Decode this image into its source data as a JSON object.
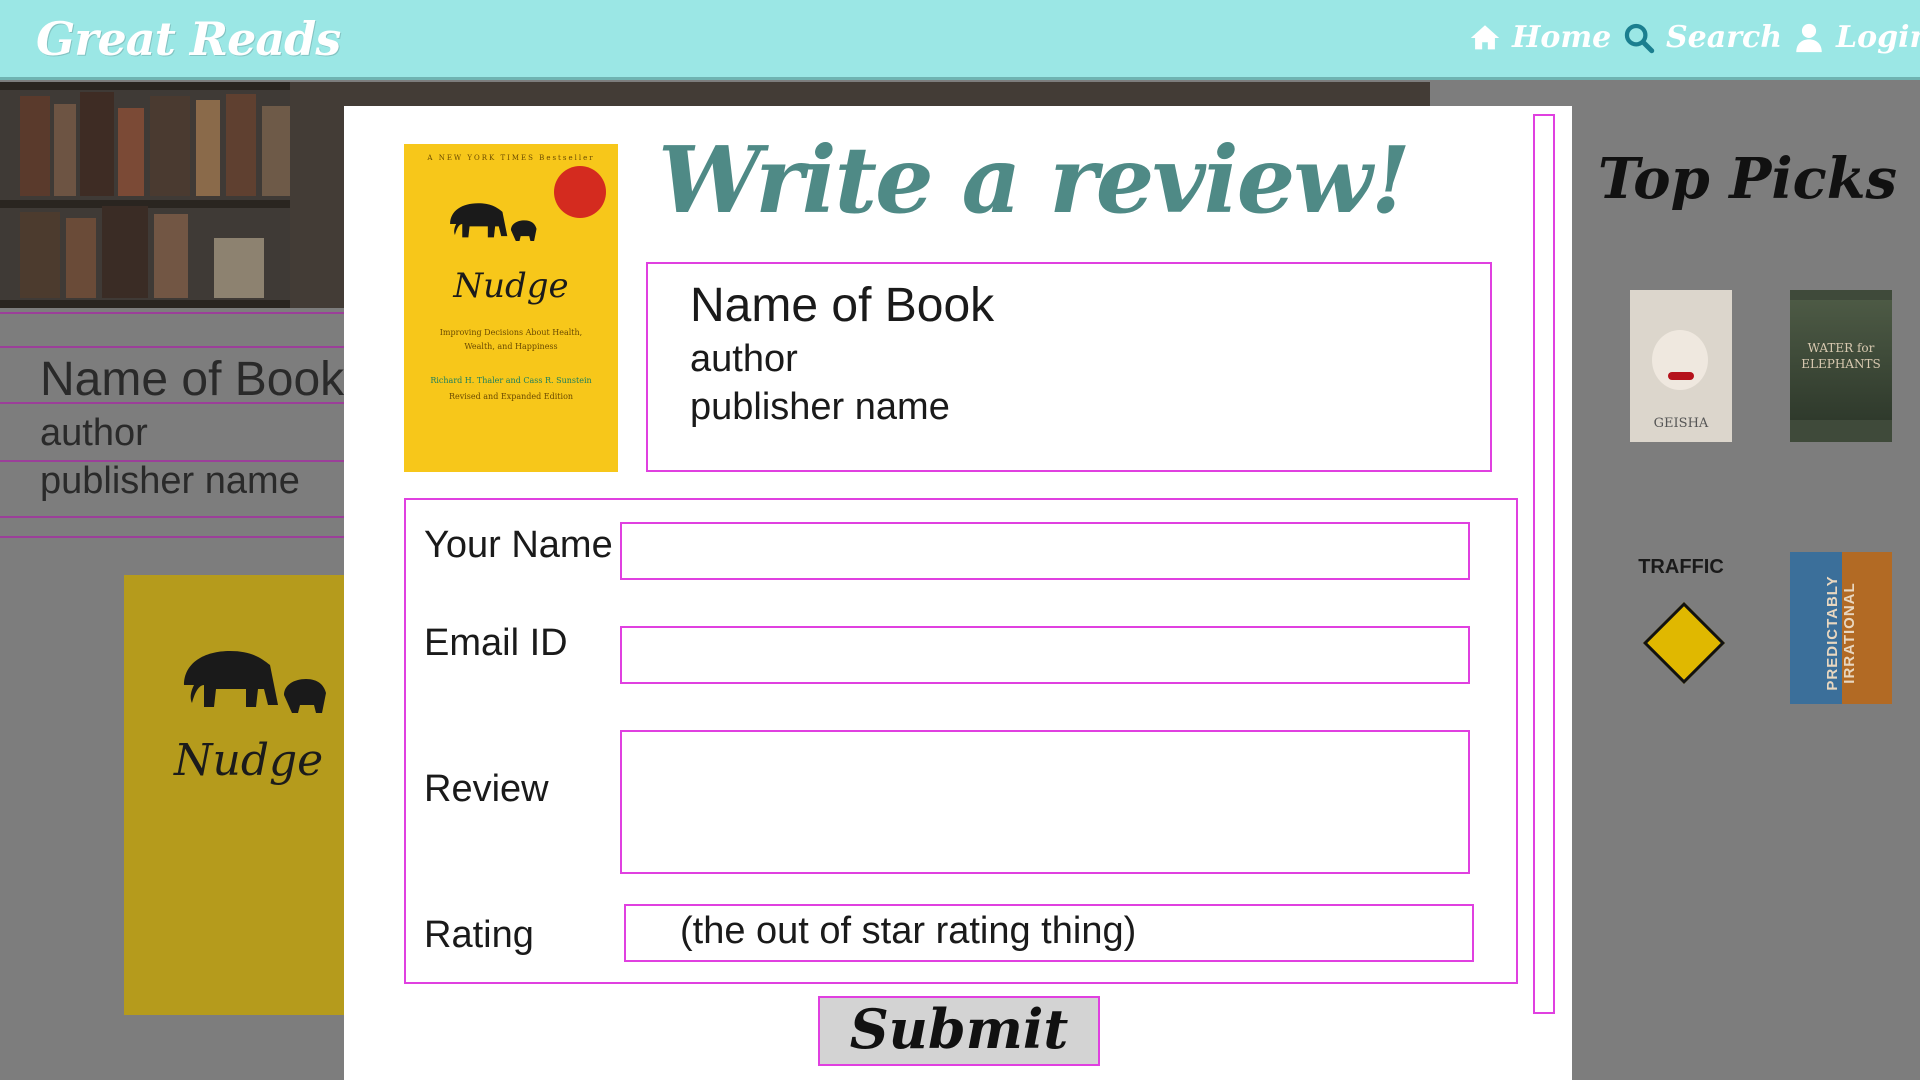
{
  "header": {
    "brand": "Great Reads",
    "nav": [
      {
        "label": "Home",
        "icon": "home-icon"
      },
      {
        "label": "Search",
        "icon": "search-icon"
      },
      {
        "label": "Login",
        "icon": "user-icon"
      }
    ]
  },
  "background_page": {
    "book": {
      "name": "Name of Book",
      "author": "author",
      "publisher": "publisher name",
      "cover_title": "Nudge"
    },
    "top_picks": {
      "title": "Top Picks",
      "books": [
        {
          "cover_text": "GEISHA"
        },
        {
          "cover_text": "WATER for ELEPHANTS"
        },
        {
          "cover_text": "TRAFFIC"
        },
        {
          "cover_text": "PREDICTABLY IRRATIONAL"
        }
      ]
    }
  },
  "modal": {
    "heading": "Write a review!",
    "cover": {
      "top_text": "A NEW YORK TIMES Bestseller",
      "title": "Nudge",
      "subtitle": "Improving Decisions About Health, Wealth, and Happiness",
      "authors": "Richard H. Thaler and Cass R. Sunstein",
      "edition": "Revised and Expanded Edition"
    },
    "book": {
      "name": "Name of Book",
      "author": "author",
      "publisher": "publisher name"
    },
    "form": {
      "name_label": "Your Name",
      "email_label": "Email ID",
      "review_label": "Review",
      "rating_label": "Rating",
      "rating_placeholder": "(the out of star rating thing)",
      "name_value": "",
      "email_value": "",
      "review_value": ""
    },
    "submit_label": "Submit"
  },
  "colors": {
    "header_bg": "#9be7e5",
    "heading": "#4f8a86",
    "outline": "#e040e0",
    "overlay": "#7d7d7d",
    "submit_bg": "#d3d3d3"
  }
}
